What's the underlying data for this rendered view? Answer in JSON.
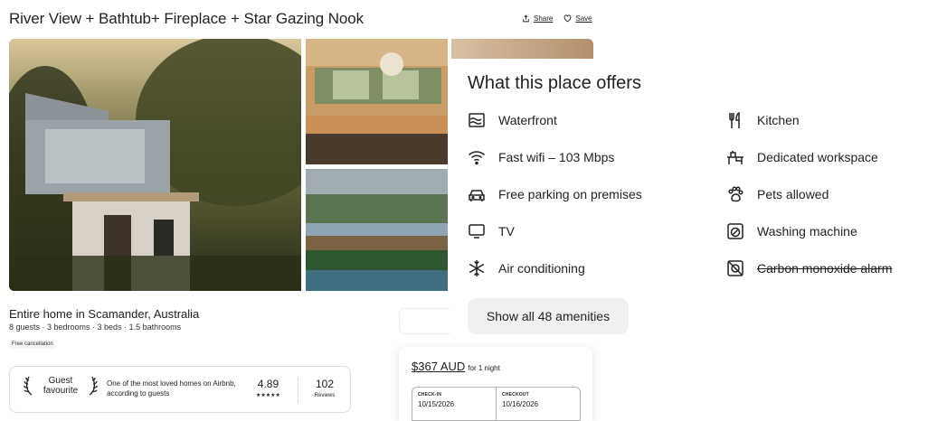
{
  "listing": {
    "title": "River View + Bathtub+ Fireplace + Star Gazing Nook",
    "share_label": "Share",
    "save_label": "Save",
    "subtitle": "Entire home in Scamander, Australia",
    "meta": "8 guests · 3 bedrooms · 3 beds · 1.5 bathrooms",
    "cancellation_tag": "Free cancellation"
  },
  "guest_favourite": {
    "label_line1": "Guest",
    "label_line2": "favourite",
    "description": "One of the most loved homes on Airbnb, according to guests",
    "rating": "4.89",
    "stars": "★★★★★",
    "reviews_count": "102",
    "reviews_label": "Reviews"
  },
  "amenities": {
    "heading": "What this place offers",
    "items": [
      {
        "label": "Waterfront",
        "icon": "waterfront-icon"
      },
      {
        "label": "Fast wifi – 103 Mbps",
        "icon": "wifi-icon"
      },
      {
        "label": "Free parking on premises",
        "icon": "car-icon"
      },
      {
        "label": "TV",
        "icon": "tv-icon"
      },
      {
        "label": "Air conditioning",
        "icon": "snowflake-icon"
      },
      {
        "label": "Kitchen",
        "icon": "utensils-icon"
      },
      {
        "label": "Dedicated workspace",
        "icon": "desk-icon"
      },
      {
        "label": "Pets allowed",
        "icon": "paw-icon"
      },
      {
        "label": "Washing machine",
        "icon": "washing-machine-icon"
      },
      {
        "label": "Carbon monoxide alarm",
        "icon": "co-alarm-icon",
        "unavailable": true
      }
    ],
    "show_all_label": "Show all 48 amenities"
  },
  "booking": {
    "price": "$367 AUD",
    "per": "for 1 night",
    "checkin_label": "CHECK-IN",
    "checkin_value": "10/15/2026",
    "checkout_label": "CHECKOUT",
    "checkout_value": "10/16/2026"
  }
}
